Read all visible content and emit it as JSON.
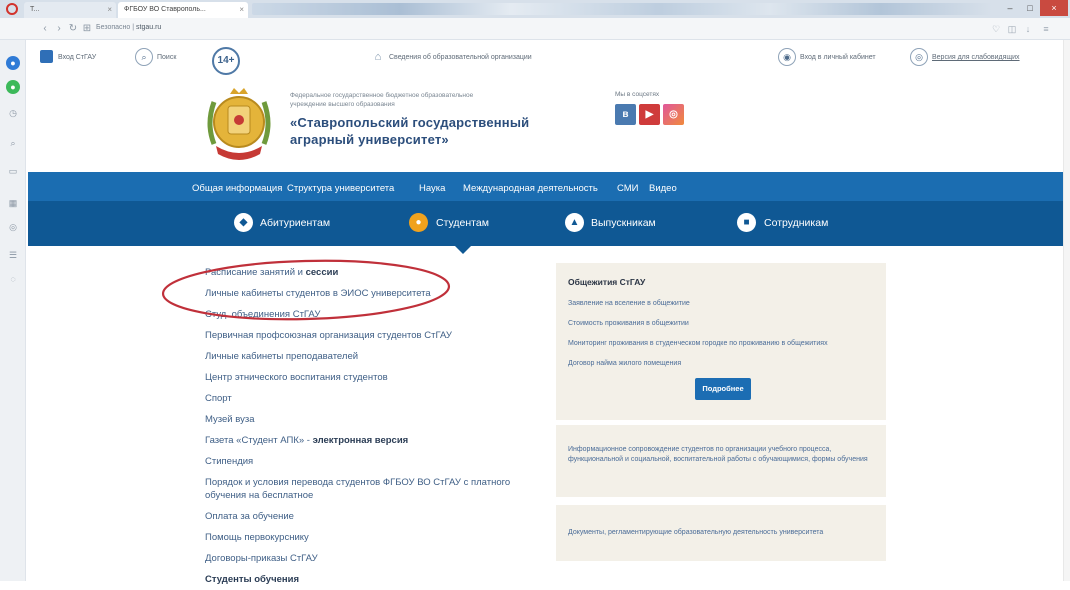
{
  "browser": {
    "tabs": [
      {
        "label": "Т..."
      },
      {
        "label": "ФГБОУ ВО Ставрополь..."
      }
    ],
    "tab_close": "×",
    "url_prefix": "Безопасно |",
    "url": "stgau.ru",
    "window": {
      "minimize": "–",
      "maximize": "□",
      "close": "×"
    }
  },
  "header": {
    "login_label": "Вход СтГАУ",
    "search_label": "Поиск",
    "age_badge": "14+",
    "info_label": "Сведения об образовательной организации",
    "cabinet_label": "Вход в личный кабинет",
    "accessibility_label": "Версия для слабовидящих"
  },
  "brand": {
    "gov_line_1": "Федеральное государственное бюджетное образовательное",
    "gov_line_2": "учреждение высшего образования",
    "title_line_1": "«Ставропольский государственный",
    "title_line_2": "аграрный университет»",
    "social_label": "Мы в соцсетях"
  },
  "nav": {
    "items": [
      "Общая информация",
      "Структура университета",
      "Наука",
      "Международная деятельность",
      "СМИ",
      "Видео"
    ]
  },
  "audience_tabs": [
    {
      "label": "Абитуриентам",
      "active": false
    },
    {
      "label": "Студентам",
      "active": true
    },
    {
      "label": "Выпускникам",
      "active": false
    },
    {
      "label": "Сотрудникам",
      "active": false
    }
  ],
  "students_menu": [
    {
      "text": "Расписание занятий и ",
      "bold": "сессии"
    },
    {
      "text": "Личные кабинеты студентов в ЭИОС университета"
    },
    {
      "text": "Студ. объединения СтГАУ"
    },
    {
      "text": "Первичная профсоюзная организация студентов СтГАУ"
    },
    {
      "text": "Личные кабинеты преподавателей"
    },
    {
      "text": "Центр этнического воспитания студентов"
    },
    {
      "text": "Спорт"
    },
    {
      "text": "Музей вуза"
    },
    {
      "text": "Газета «Студент АПК» - ",
      "bold": "электронная версия"
    },
    {
      "text": "Стипендия"
    },
    {
      "text": "Порядок и условия перевода студентов ФГБОУ ВО СтГАУ с платного обучения на бесплатное"
    },
    {
      "text": "Оплата за обучение"
    },
    {
      "text": "Помощь первокурснику"
    },
    {
      "text": "Договоры-приказы СтГАУ"
    },
    {
      "text": "",
      "bold": "Студенты обучения"
    }
  ],
  "dorm_box": {
    "title": "Общежития СтГАУ",
    "links": [
      "Заявление на вселение в общежитие",
      "Стоимость проживания в общежитии",
      "Мониторинг проживания в студенческом городке по проживанию в общежитиях",
      "Договор найма жилого помещения"
    ],
    "button": "Подробнее"
  },
  "notice_box": {
    "text": "Информационное сопровождение студентов по организации учебного процесса, функциональной и социальной, воспитательной работы с обучающимися, формы обучения"
  },
  "docs_box": {
    "text": "Документы, регламентирующие образовательную деятельность университета"
  },
  "colors": {
    "nav_top": "#1b6db1",
    "nav_bottom": "#0f5894",
    "active_tab_icon": "#f0a21e",
    "highlight_ellipse": "#c0303a",
    "panel_bg": "#f3f0e8",
    "button": "#1c6db3"
  },
  "icons": {
    "sidebar": [
      "messenger-icon",
      "whatsapp-icon",
      "history-icon",
      "search-icon",
      "news-icon",
      "bookmarks-icon",
      "extensions-icon",
      "settings-icon",
      "downloads-icon"
    ],
    "tabs": [
      "applicant-icon",
      "student-icon",
      "graduate-icon",
      "staff-icon"
    ]
  }
}
